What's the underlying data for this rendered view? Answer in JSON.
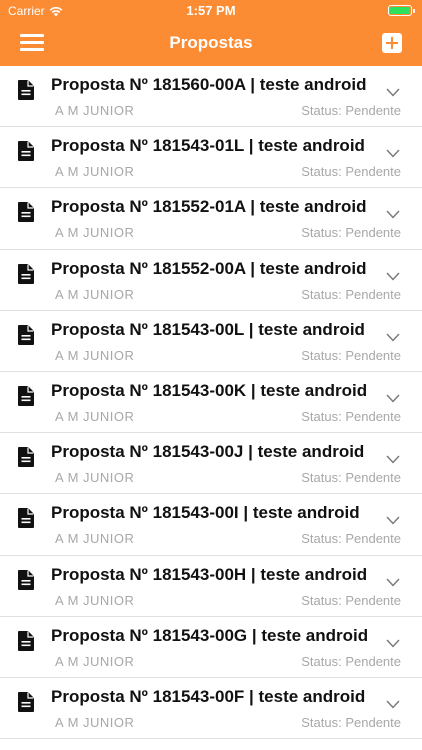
{
  "status_bar": {
    "carrier": "Carrier",
    "time": "1:57 PM"
  },
  "header": {
    "title": "Propostas",
    "menu_icon": "hamburger-icon",
    "add_icon": "plus-square-icon",
    "accent_color": "#fb8c34"
  },
  "proposals": [
    {
      "title": "Proposta Nº 181560-00A | teste android",
      "client": "A M JUNIOR",
      "status": "Status: Pendente"
    },
    {
      "title": "Proposta Nº 181543-01L | teste android",
      "client": "A M JUNIOR",
      "status": "Status: Pendente"
    },
    {
      "title": "Proposta Nº 181552-01A | teste android",
      "client": "A M JUNIOR",
      "status": "Status: Pendente"
    },
    {
      "title": "Proposta Nº 181552-00A | teste android",
      "client": "A M JUNIOR",
      "status": "Status: Pendente"
    },
    {
      "title": "Proposta Nº 181543-00L | teste android",
      "client": "A M JUNIOR",
      "status": "Status: Pendente"
    },
    {
      "title": "Proposta Nº 181543-00K | teste android",
      "client": "A M JUNIOR",
      "status": "Status: Pendente"
    },
    {
      "title": "Proposta Nº 181543-00J | teste android",
      "client": "A M JUNIOR",
      "status": "Status: Pendente"
    },
    {
      "title": "Proposta Nº 181543-00I | teste android",
      "client": "A M JUNIOR",
      "status": "Status: Pendente"
    },
    {
      "title": "Proposta Nº 181543-00H | teste android",
      "client": "A M JUNIOR",
      "status": "Status: Pendente"
    },
    {
      "title": "Proposta Nº 181543-00G | teste android",
      "client": "A M JUNIOR",
      "status": "Status: Pendente"
    },
    {
      "title": "Proposta Nº 181543-00F | teste android",
      "client": "A M JUNIOR",
      "status": "Status: Pendente"
    }
  ]
}
